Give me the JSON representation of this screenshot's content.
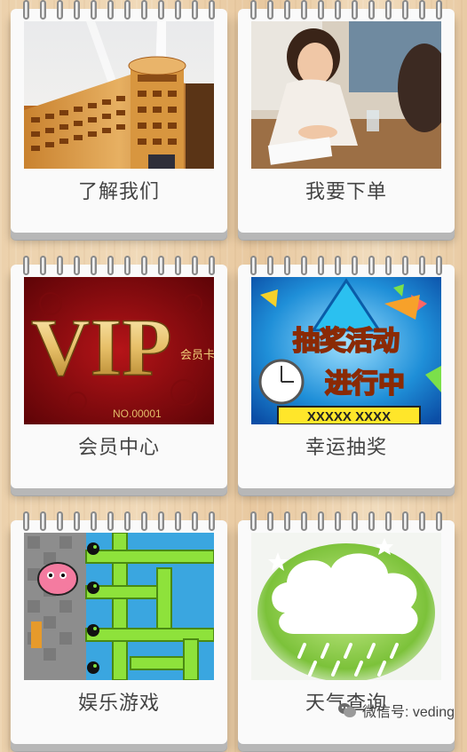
{
  "tiles": [
    {
      "label": "了解我们",
      "image": "hotel-building"
    },
    {
      "label": "我要下单",
      "image": "woman-ordering"
    },
    {
      "label": "会员中心",
      "image": "vip-card",
      "image_text": [
        "VIP",
        "会员卡",
        "NO.00001"
      ]
    },
    {
      "label": "幸运抽奖",
      "image": "lottery-banner",
      "image_text": [
        "抽奖活动",
        "进行中",
        "XXXXX XXXX"
      ]
    },
    {
      "label": "娱乐游戏",
      "image": "pipe-game"
    },
    {
      "label": "天气查询",
      "image": "weather-cloud"
    }
  ],
  "watermark": {
    "text": "微信号: veding",
    "icon": "wechat-icon"
  },
  "colors": {
    "card": "#fafafa",
    "label": "#444444",
    "wood": "#ecd1ac"
  }
}
